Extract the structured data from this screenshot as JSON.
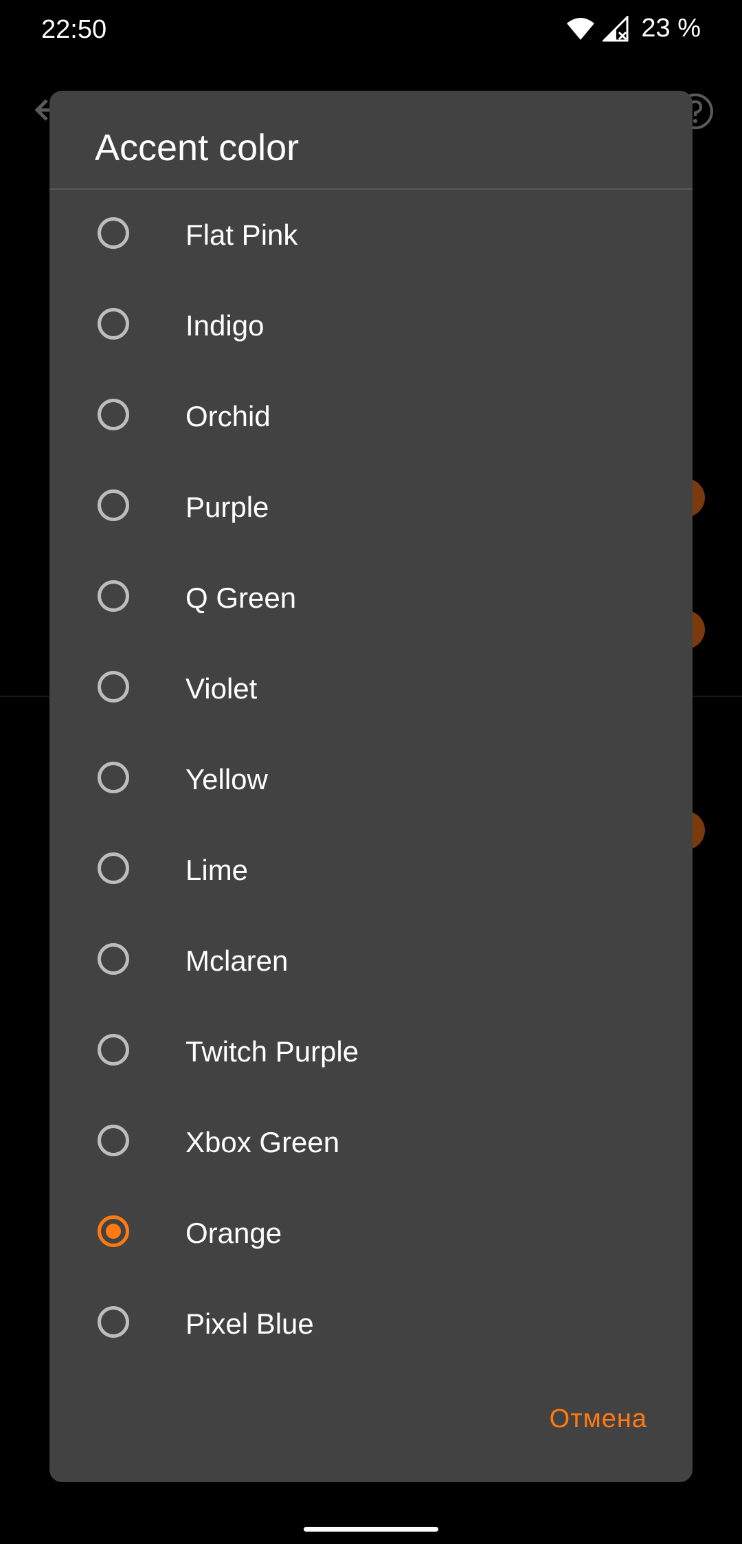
{
  "status_bar": {
    "time": "22:50",
    "battery": "23 %",
    "icons": [
      "wifi-icon",
      "signal-icon",
      "battery-text"
    ]
  },
  "background": {
    "icons": [
      "back-arrow-icon",
      "help-icon"
    ],
    "accent_dot_color": "#7a3a0e"
  },
  "dialog": {
    "title": "Accent color",
    "options": [
      {
        "label": "Flat Pink",
        "selected": false
      },
      {
        "label": "Indigo",
        "selected": false
      },
      {
        "label": "Orchid",
        "selected": false
      },
      {
        "label": "Purple",
        "selected": false
      },
      {
        "label": "Q Green",
        "selected": false
      },
      {
        "label": "Violet",
        "selected": false
      },
      {
        "label": "Yellow",
        "selected": false
      },
      {
        "label": "Lime",
        "selected": false
      },
      {
        "label": "Mclaren",
        "selected": false
      },
      {
        "label": "Twitch Purple",
        "selected": false
      },
      {
        "label": "Xbox Green",
        "selected": false
      },
      {
        "label": "Orange",
        "selected": true
      },
      {
        "label": "Pixel Blue",
        "selected": false
      }
    ],
    "cancel_label": "Отмена"
  },
  "colors": {
    "accent": "#ff7a12",
    "dialog_bg": "#424242",
    "screen_bg": "#000000",
    "radio_unchecked": "#bdbdbd"
  }
}
